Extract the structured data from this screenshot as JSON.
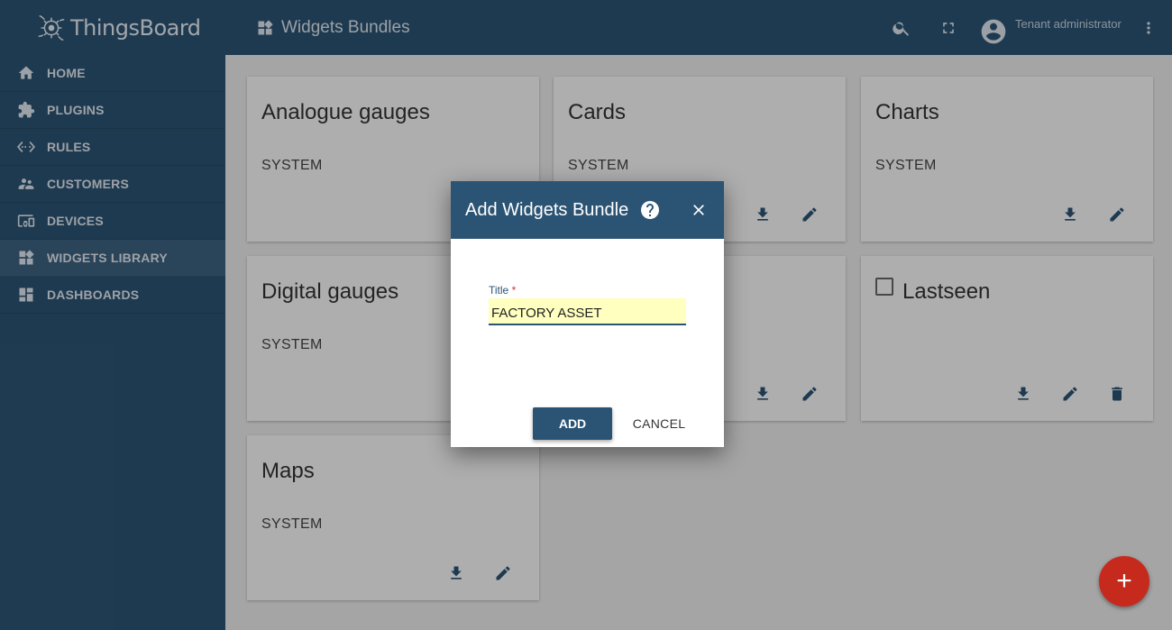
{
  "app": {
    "name": "ThingsBoard"
  },
  "sidebar": {
    "items": [
      {
        "label": "HOME",
        "icon": "home-icon"
      },
      {
        "label": "PLUGINS",
        "icon": "puzzle-icon"
      },
      {
        "label": "RULES",
        "icon": "settings-ethernet-icon"
      },
      {
        "label": "CUSTOMERS",
        "icon": "supervisor-account-icon"
      },
      {
        "label": "DEVICES",
        "icon": "devices-other-icon"
      },
      {
        "label": "WIDGETS LIBRARY",
        "icon": "widgets-icon",
        "active": true
      },
      {
        "label": "DASHBOARDS",
        "icon": "dashboard-icon"
      }
    ]
  },
  "header": {
    "title": "Widgets Bundles",
    "user_role": "Tenant administrator"
  },
  "cards": [
    {
      "title": "Analogue gauges",
      "subtitle": "SYSTEM"
    },
    {
      "title": "Cards",
      "subtitle": "SYSTEM"
    },
    {
      "title": "Charts",
      "subtitle": "SYSTEM"
    },
    {
      "title": "Digital gauges",
      "subtitle": "SYSTEM"
    },
    {
      "title": "",
      "subtitle": ""
    },
    {
      "title": "Lastseen",
      "subtitle": ""
    },
    {
      "title": "Maps",
      "subtitle": "SYSTEM"
    }
  ],
  "dialog": {
    "title": "Add Widgets Bundle",
    "field_label": "Title",
    "required_mark": "*",
    "field_value": "FACTORY ASSET",
    "add_label": "ADD",
    "cancel_label": "CANCEL"
  },
  "fab": {
    "label": "+"
  },
  "colors": {
    "primary": "#2b5474",
    "accent": "#c62a1d",
    "input_highlight": "#ffffbf"
  }
}
